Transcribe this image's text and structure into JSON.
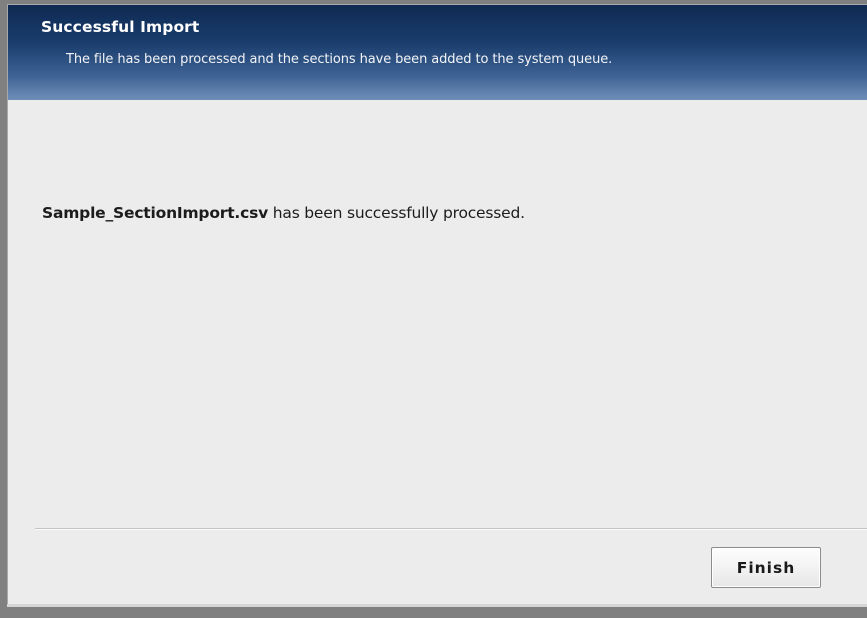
{
  "header": {
    "title": "Successful Import",
    "subtitle": "The file has been processed and the sections have been added to the system queue."
  },
  "message": {
    "filename": "Sample_SectionImport.csv",
    "text": " has been successfully processed."
  },
  "actions": {
    "finish_label": "Finish"
  }
}
